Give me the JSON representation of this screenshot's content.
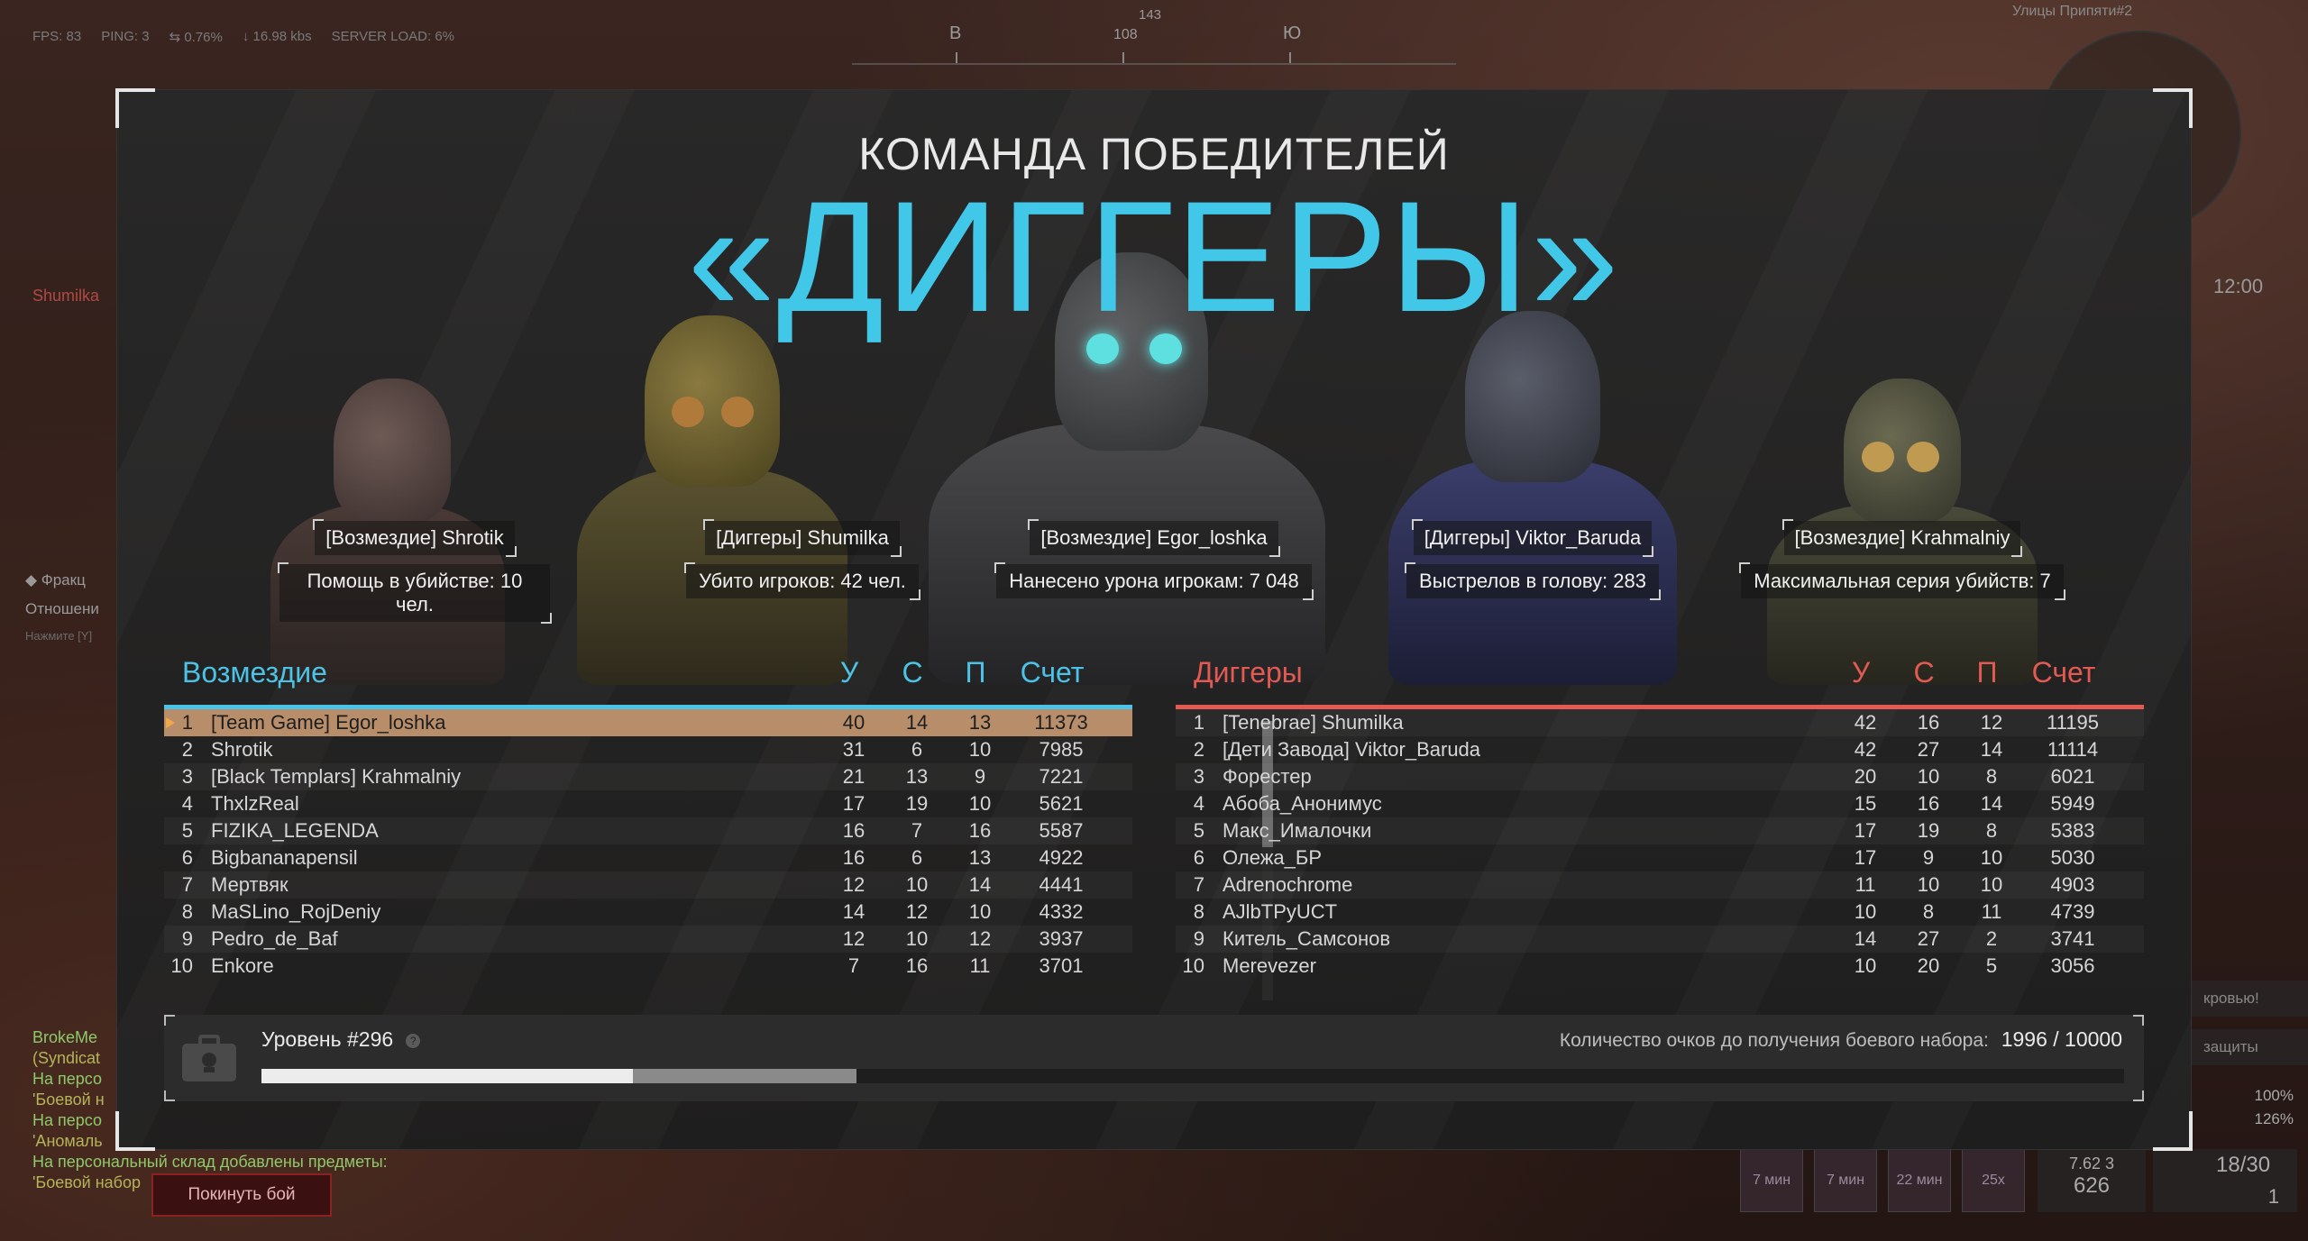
{
  "hud": {
    "fps": "FPS: 83",
    "ping": "PING: 3",
    "loss": "0.76%",
    "traffic": "16.98 kbs",
    "server_load": "SERVER LOAD: 6%",
    "compass_degree": "143",
    "compass_left": "В",
    "compass_mid": "108",
    "compass_right": "Ю",
    "map_name": "Улицы Припяти#2",
    "clock": "12:00",
    "player_tag": "Shumilka",
    "faction_title": "Фракц",
    "faction_relations": "Отношени",
    "faction_hint": "Нажмите [Y]"
  },
  "chat": [
    {
      "text": "BrokeMe",
      "color": "g"
    },
    {
      "text": "(Syndicat",
      "color": "y"
    },
    {
      "text": "На персо",
      "color": "g"
    },
    {
      "text": "'Боевой н",
      "color": "y"
    },
    {
      "text": "На персо",
      "color": "g"
    },
    {
      "text": "'Аномаль",
      "color": "y"
    },
    {
      "text": "На персональный склад добавлены предметы:",
      "color": "g"
    },
    {
      "text": "'Боевой набор",
      "color": "y"
    }
  ],
  "leave_button": "Покинуть бой",
  "right_hud": {
    "btn1": "кровью!",
    "btn2": "защиты",
    "pct1": "100%",
    "pct2": "126%",
    "slots": [
      "7 мин",
      "7 мин",
      "22 мин"
    ],
    "multiplier": "25x",
    "ammo_type": "7.62 3",
    "ammo_total": "626",
    "mag": "18/30",
    "grenades": "1"
  },
  "winners": {
    "title": "КОМАНДА ПОБЕДИТЕЛЕЙ",
    "team": "«ДИГГЕРЫ»"
  },
  "awards": [
    {
      "name": "[Возмездие] Shrotik",
      "stat": "Помощь в убийстве: 10 чел."
    },
    {
      "name": "[Диггеры] Shumilka",
      "stat": "Убито игроков: 42 чел."
    },
    {
      "name": "[Возмездие] Egor_loshka",
      "stat": "Нанесено урона игрокам: 7 048"
    },
    {
      "name": "[Диггеры] Viktor_Baruda",
      "stat": "Выстрелов в голову: 283"
    },
    {
      "name": "[Возмездие] Krahmalniy",
      "stat": "Максимальная серия убийств: 7"
    }
  ],
  "columns": {
    "kills": "У",
    "deaths": "С",
    "assists": "П",
    "score": "Счет"
  },
  "team_left": {
    "name": "Возмездие",
    "color": "#4cc3e6",
    "rows": [
      {
        "rank": "1",
        "name": "[Team Game] Egor_loshka",
        "k": "40",
        "d": "14",
        "a": "13",
        "s": "11373",
        "me": true
      },
      {
        "rank": "2",
        "name": "Shrotik",
        "k": "31",
        "d": "6",
        "a": "10",
        "s": "7985"
      },
      {
        "rank": "3",
        "name": "[Black Templars] Krahmalniy",
        "k": "21",
        "d": "13",
        "a": "9",
        "s": "7221"
      },
      {
        "rank": "4",
        "name": "ThxlzReal",
        "k": "17",
        "d": "19",
        "a": "10",
        "s": "5621"
      },
      {
        "rank": "5",
        "name": "FIZIKA_LEGENDA",
        "k": "16",
        "d": "7",
        "a": "16",
        "s": "5587"
      },
      {
        "rank": "6",
        "name": "Bigbananapensil",
        "k": "16",
        "d": "6",
        "a": "13",
        "s": "4922"
      },
      {
        "rank": "7",
        "name": "Мертвяк",
        "k": "12",
        "d": "10",
        "a": "14",
        "s": "4441"
      },
      {
        "rank": "8",
        "name": "MaSLino_RojDeniy",
        "k": "14",
        "d": "12",
        "a": "10",
        "s": "4332"
      },
      {
        "rank": "9",
        "name": "Pedro_de_Baf",
        "k": "12",
        "d": "10",
        "a": "12",
        "s": "3937"
      },
      {
        "rank": "10",
        "name": "Enkore",
        "k": "7",
        "d": "16",
        "a": "11",
        "s": "3701"
      }
    ]
  },
  "team_right": {
    "name": "Диггеры",
    "color": "#e25a52",
    "rows": [
      {
        "rank": "1",
        "name": "[Tenebrae] Shumilka",
        "k": "42",
        "d": "16",
        "a": "12",
        "s": "11195"
      },
      {
        "rank": "2",
        "name": "[Дети Завода] Viktor_Baruda",
        "k": "42",
        "d": "27",
        "a": "14",
        "s": "11114"
      },
      {
        "rank": "3",
        "name": "Форестер",
        "k": "20",
        "d": "10",
        "a": "8",
        "s": "6021"
      },
      {
        "rank": "4",
        "name": "Абоба_Анонимус",
        "k": "15",
        "d": "16",
        "a": "14",
        "s": "5949"
      },
      {
        "rank": "5",
        "name": "Макс_Ималочки",
        "k": "17",
        "d": "19",
        "a": "8",
        "s": "5383"
      },
      {
        "rank": "6",
        "name": "Олежа_БР",
        "k": "17",
        "d": "9",
        "a": "10",
        "s": "5030"
      },
      {
        "rank": "7",
        "name": "Adrenochrome",
        "k": "11",
        "d": "10",
        "a": "10",
        "s": "4903"
      },
      {
        "rank": "8",
        "name": "AJlbTPyUCT",
        "k": "10",
        "d": "8",
        "a": "11",
        "s": "4739"
      },
      {
        "rank": "9",
        "name": "Китель_Самсонов",
        "k": "14",
        "d": "27",
        "a": "2",
        "s": "3741"
      },
      {
        "rank": "10",
        "name": "Merevezer",
        "k": "10",
        "d": "20",
        "a": "5",
        "s": "3056"
      }
    ]
  },
  "level": {
    "label": "Уровень #296",
    "points_label": "Количество очков до получения боевого набора:",
    "points_value": "1996 / 10000",
    "progress": 0.1996,
    "progress_secondary": 0.12
  }
}
